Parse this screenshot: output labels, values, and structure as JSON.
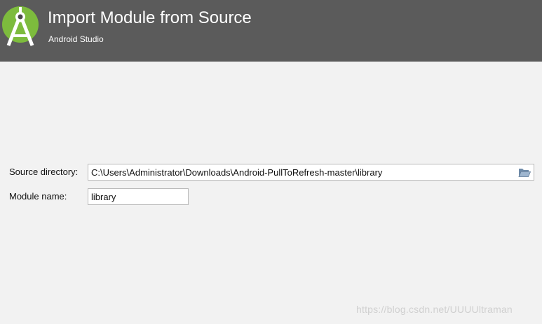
{
  "header": {
    "title": "Import Module from Source",
    "subtitle": "Android Studio",
    "logo_icon": "android-studio-logo-icon",
    "background_color": "#5b5b5b",
    "logo_color": "#7dbb3d"
  },
  "form": {
    "source_directory": {
      "label": "Source directory:",
      "value": "C:\\Users\\Administrator\\Downloads\\Android-PullToRefresh-master\\library",
      "browse_icon": "folder-open-icon"
    },
    "module_name": {
      "label": "Module name:",
      "value": "library"
    }
  },
  "watermark": "https://blog.csdn.net/UUUUltraman"
}
